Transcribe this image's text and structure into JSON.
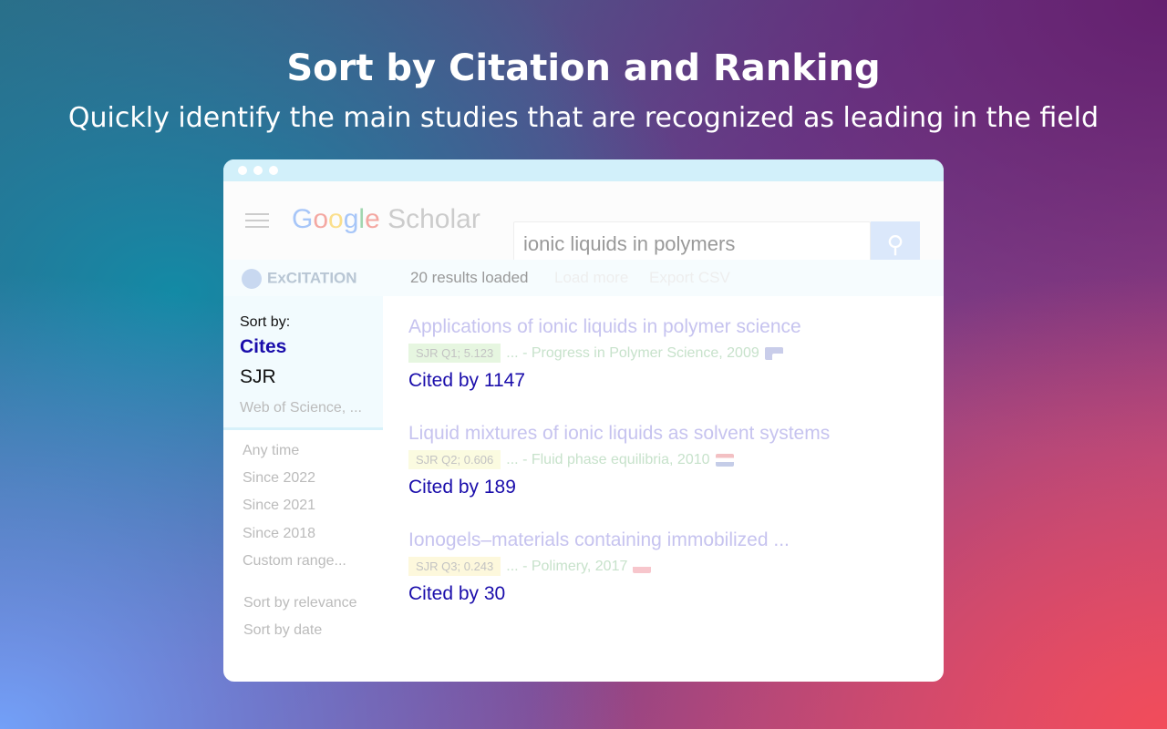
{
  "headline": "Sort by Citation and Ranking",
  "subheadline": "Quickly identify the main studies that are recognized as leading in the field",
  "header": {
    "logo": "Google Scholar",
    "search_value": "ionic liquids in polymers"
  },
  "extension": {
    "name": "ExCITATION",
    "status": "20 results loaded",
    "load_more": "Load more",
    "export": "Export CSV"
  },
  "sort": {
    "label": "Sort by:",
    "options": [
      "Cites",
      "SJR",
      "Web of Science, ..."
    ],
    "selected": "Cites"
  },
  "filters": [
    "Any time",
    "Since 2022",
    "Since 2021",
    "Since 2018",
    "Custom range..."
  ],
  "sort_links": [
    "Sort by relevance",
    "Sort by date"
  ],
  "results": [
    {
      "title": "Applications of ionic liquids  in polymer  science",
      "badge": "SJR Q1; 5.123",
      "badge_color": "#e6f6e0",
      "source": "... - Progress in Polymer  Science, 2009",
      "flag": "us",
      "cited": "Cited by 1147"
    },
    {
      "title": "Liquid mixtures of ionic liquids as solvent systems",
      "badge": "SJR Q2; 0.606",
      "badge_color": "#fbfbe0",
      "source": "... - Fluid phase equilibria, 2010",
      "flag": "nl",
      "cited": "Cited by 189"
    },
    {
      "title": "Ionogels–materials containing immobilized ...",
      "badge": "SJR Q3; 0.243",
      "badge_color": "#fdf8dc",
      "source": "... - Polimery, 2017",
      "flag": "pl",
      "cited": "Cited by 30"
    }
  ]
}
